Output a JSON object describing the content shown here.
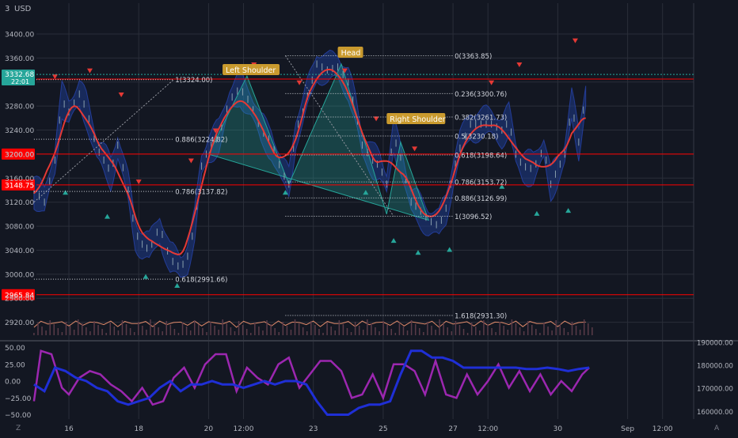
{
  "currency": "USD",
  "currency_prefix": "3",
  "colors": {
    "background": "#131722",
    "grid": "#2a2e39",
    "axis_text": "#b2b5be",
    "price_line": "#ff0000",
    "candle": "#8aa0ad",
    "band": "#1e3a8a",
    "band_edge": "#2d4fd0",
    "ma": "#e53935",
    "pattern_fill": "#26a69a",
    "label_bg": "#c99a2e",
    "label_text": "#ffffff",
    "up_marker": "#26a69a",
    "down_marker": "#e53935",
    "volume_line": "#e08a6a",
    "osc_purple": "#9c27b0",
    "osc_blue": "#1f2fd6",
    "current_badge": "#26a69a"
  },
  "current_price": {
    "price": "3332.68",
    "timer": "22:01",
    "value": 3332.68
  },
  "price_axis_ticks": [
    "3400.00",
    "3360.00",
    "3320.00",
    "3280.00",
    "3240.00",
    "3200.00",
    "3160.00",
    "3120.00",
    "3080.00",
    "3040.00",
    "3000.00",
    "2960.00",
    "2920.00"
  ],
  "price_lines": [
    {
      "label": "3324.90",
      "value": 3324.9
    },
    {
      "label": "3200.00",
      "value": 3200.0
    },
    {
      "label": "3148.75",
      "value": 3148.75
    },
    {
      "label": "2965.84",
      "value": 2965.84
    }
  ],
  "oscillator_axis_ticks": [
    "50.00",
    "25.00",
    "0.00",
    "−25.00",
    "−50.00"
  ],
  "volume_axis_ticks": [
    "190000.00",
    "180000.00",
    "170000.00",
    "160000.00"
  ],
  "time_axis_labels": [
    "16",
    "18",
    "20",
    "12:00",
    "23",
    "25",
    "27",
    "12:00",
    "30",
    "Sep",
    "12:00"
  ],
  "fib_left": [
    {
      "label": "1(3324.00)",
      "value": 3324.0
    },
    {
      "label": "0.886(3224.82)",
      "value": 3224.82
    },
    {
      "label": "0.786(3137.82)",
      "value": 3137.82
    },
    {
      "label": "0.618(2991.66)",
      "value": 2991.66
    }
  ],
  "fib_right": [
    {
      "label": "0(3363.85)",
      "value": 3363.85
    },
    {
      "label": "0.236(3300.76)",
      "value": 3300.76
    },
    {
      "label": "0.382(3261.73)",
      "value": 3261.73
    },
    {
      "label": "0.5(3230.18)",
      "value": 3230.18
    },
    {
      "label": "0.618(3198.64)",
      "value": 3198.64
    },
    {
      "label": "0.786(3153.72)",
      "value": 3153.72
    },
    {
      "label": "0.886(3126.99)",
      "value": 3126.99
    },
    {
      "label": "1(3096.52)",
      "value": 3096.52
    },
    {
      "label": "1.618(2931.30)",
      "value": 2931.3
    }
  ],
  "pattern_labels": {
    "left_shoulder": "Left Shoulder",
    "head": "Head",
    "right_shoulder": "Right Shoulder"
  },
  "corner_icons": {
    "left": "Z",
    "right": "A"
  },
  "chart_data": {
    "type": "candlestick",
    "y_range": [
      2900,
      3420
    ],
    "x": [
      "16",
      "18",
      "20",
      "12:00",
      "23",
      "25",
      "27",
      "12:00",
      "30",
      "Sep",
      "12:00"
    ],
    "series": [
      {
        "values": [
          [
            15.0,
            3140
          ],
          [
            15.3,
            3120
          ],
          [
            15.6,
            3190
          ],
          [
            15.8,
            3290
          ],
          [
            16.0,
            3270
          ],
          [
            16.3,
            3300
          ],
          [
            16.5,
            3275
          ],
          [
            16.8,
            3210
          ],
          [
            17.0,
            3190
          ],
          [
            17.2,
            3170
          ],
          [
            17.4,
            3215
          ],
          [
            17.7,
            3140
          ],
          [
            17.9,
            3070
          ],
          [
            18.1,
            3050
          ],
          [
            18.3,
            3040
          ],
          [
            18.6,
            3080
          ],
          [
            18.9,
            3025
          ],
          [
            19.2,
            3010
          ],
          [
            19.4,
            3030
          ],
          [
            19.6,
            3080
          ],
          [
            19.8,
            3180
          ],
          [
            20.0,
            3210
          ],
          [
            20.3,
            3230
          ],
          [
            20.6,
            3290
          ],
          [
            20.9,
            3310
          ],
          [
            21.2,
            3285
          ],
          [
            21.5,
            3240
          ],
          [
            21.8,
            3220
          ],
          [
            22.1,
            3170
          ],
          [
            22.3,
            3150
          ],
          [
            22.5,
            3240
          ],
          [
            22.7,
            3270
          ],
          [
            22.9,
            3310
          ],
          [
            23.1,
            3350
          ],
          [
            23.4,
            3340
          ],
          [
            23.7,
            3345
          ],
          [
            24.0,
            3320
          ],
          [
            24.2,
            3275
          ],
          [
            24.4,
            3215
          ],
          [
            24.7,
            3190
          ],
          [
            24.9,
            3180
          ],
          [
            25.1,
            3150
          ],
          [
            25.3,
            3230
          ],
          [
            25.5,
            3195
          ],
          [
            25.8,
            3120
          ],
          [
            26.0,
            3110
          ],
          [
            26.3,
            3090
          ],
          [
            26.6,
            3080
          ],
          [
            26.8,
            3110
          ],
          [
            27.0,
            3170
          ],
          [
            27.2,
            3210
          ],
          [
            27.5,
            3250
          ],
          [
            27.8,
            3250
          ],
          [
            28.1,
            3250
          ],
          [
            28.4,
            3240
          ],
          [
            28.6,
            3255
          ],
          [
            28.8,
            3200
          ],
          [
            29.0,
            3180
          ],
          [
            29.3,
            3175
          ],
          [
            29.6,
            3210
          ],
          [
            29.8,
            3150
          ],
          [
            30.0,
            3175
          ],
          [
            30.2,
            3200
          ],
          [
            30.4,
            3280
          ],
          [
            30.6,
            3220
          ],
          [
            30.8,
            3300
          ]
        ]
      }
    ],
    "oscillator": {
      "y_range": [
        -60,
        60
      ],
      "purple": [
        [
          15.0,
          -30
        ],
        [
          15.2,
          45
        ],
        [
          15.5,
          40
        ],
        [
          15.8,
          -10
        ],
        [
          16.0,
          -20
        ],
        [
          16.3,
          5
        ],
        [
          16.6,
          15
        ],
        [
          16.9,
          10
        ],
        [
          17.2,
          -5
        ],
        [
          17.5,
          -15
        ],
        [
          17.8,
          -30
        ],
        [
          18.1,
          -10
        ],
        [
          18.4,
          -35
        ],
        [
          18.7,
          -30
        ],
        [
          19.0,
          5
        ],
        [
          19.3,
          20
        ],
        [
          19.6,
          -10
        ],
        [
          19.9,
          25
        ],
        [
          20.2,
          40
        ],
        [
          20.5,
          40
        ],
        [
          20.8,
          -15
        ],
        [
          21.1,
          20
        ],
        [
          21.4,
          5
        ],
        [
          21.7,
          -5
        ],
        [
          22.0,
          25
        ],
        [
          22.3,
          35
        ],
        [
          22.6,
          -10
        ],
        [
          22.9,
          10
        ],
        [
          23.2,
          30
        ],
        [
          23.5,
          30
        ],
        [
          23.8,
          15
        ],
        [
          24.1,
          -25
        ],
        [
          24.4,
          -20
        ],
        [
          24.7,
          10
        ],
        [
          25.0,
          -25
        ],
        [
          25.3,
          25
        ],
        [
          25.6,
          25
        ],
        [
          25.9,
          15
        ],
        [
          26.2,
          -20
        ],
        [
          26.5,
          30
        ],
        [
          26.8,
          -20
        ],
        [
          27.1,
          -25
        ],
        [
          27.4,
          10
        ],
        [
          27.7,
          -20
        ],
        [
          28.0,
          0
        ],
        [
          28.3,
          25
        ],
        [
          28.6,
          -10
        ],
        [
          28.9,
          15
        ],
        [
          29.2,
          -15
        ],
        [
          29.5,
          10
        ],
        [
          29.8,
          -20
        ],
        [
          30.1,
          0
        ],
        [
          30.4,
          -15
        ],
        [
          30.7,
          10
        ],
        [
          30.9,
          20
        ]
      ],
      "blue": [
        [
          15.0,
          -5
        ],
        [
          15.3,
          -15
        ],
        [
          15.6,
          20
        ],
        [
          15.9,
          15
        ],
        [
          16.2,
          5
        ],
        [
          16.5,
          0
        ],
        [
          16.8,
          -10
        ],
        [
          17.1,
          -15
        ],
        [
          17.4,
          -30
        ],
        [
          17.7,
          -35
        ],
        [
          18.0,
          -30
        ],
        [
          18.3,
          -25
        ],
        [
          18.6,
          -10
        ],
        [
          18.9,
          0
        ],
        [
          19.2,
          -15
        ],
        [
          19.5,
          -5
        ],
        [
          19.8,
          -5
        ],
        [
          20.1,
          0
        ],
        [
          20.4,
          -5
        ],
        [
          20.7,
          -5
        ],
        [
          21.0,
          -10
        ],
        [
          21.3,
          -5
        ],
        [
          21.6,
          0
        ],
        [
          21.9,
          -5
        ],
        [
          22.2,
          0
        ],
        [
          22.5,
          0
        ],
        [
          22.8,
          -5
        ],
        [
          23.1,
          -30
        ],
        [
          23.4,
          -50
        ],
        [
          23.7,
          -50
        ],
        [
          24.0,
          -50
        ],
        [
          24.3,
          -40
        ],
        [
          24.6,
          -35
        ],
        [
          24.9,
          -35
        ],
        [
          25.2,
          -30
        ],
        [
          25.5,
          10
        ],
        [
          25.8,
          45
        ],
        [
          26.1,
          45
        ],
        [
          26.4,
          35
        ],
        [
          26.7,
          35
        ],
        [
          27.0,
          30
        ],
        [
          27.3,
          20
        ],
        [
          27.6,
          20
        ],
        [
          27.9,
          20
        ],
        [
          28.2,
          20
        ],
        [
          28.5,
          20
        ],
        [
          28.8,
          20
        ],
        [
          29.1,
          18
        ],
        [
          29.4,
          18
        ],
        [
          29.7,
          20
        ],
        [
          30.0,
          18
        ],
        [
          30.3,
          15
        ],
        [
          30.6,
          18
        ],
        [
          30.9,
          20
        ]
      ]
    }
  }
}
